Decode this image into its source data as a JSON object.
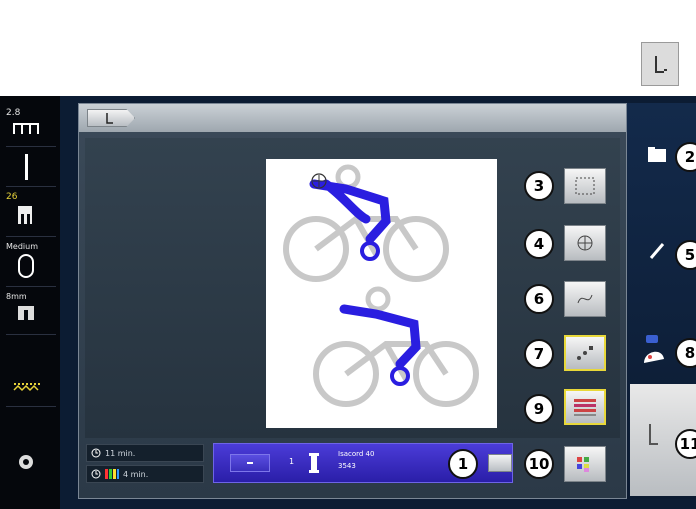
{
  "status_bar": {
    "stitch_length": "2.8",
    "presser_foot_number": "26",
    "hoop_size": "Medium",
    "needle_size": "8mm"
  },
  "time_panel": {
    "total_time": "11 min.",
    "color_time": "4 min."
  },
  "color_bar": {
    "index": "1",
    "thread_brand": "Isacord 40",
    "thread_number": "3543",
    "thread_color": "#1a1a8f"
  },
  "callouts": {
    "c1": "1",
    "c2": "2",
    "c3": "3",
    "c4": "4",
    "c5": "5",
    "c6": "6",
    "c7": "7",
    "c8": "8",
    "c9": "9",
    "c10": "10",
    "c11": "11"
  },
  "colors": {
    "design_blue": "#2a1ee0",
    "design_gray": "#c8c8c8",
    "highlight_yellow": "#e8d83a",
    "color_bar": "#3b2fd0"
  }
}
